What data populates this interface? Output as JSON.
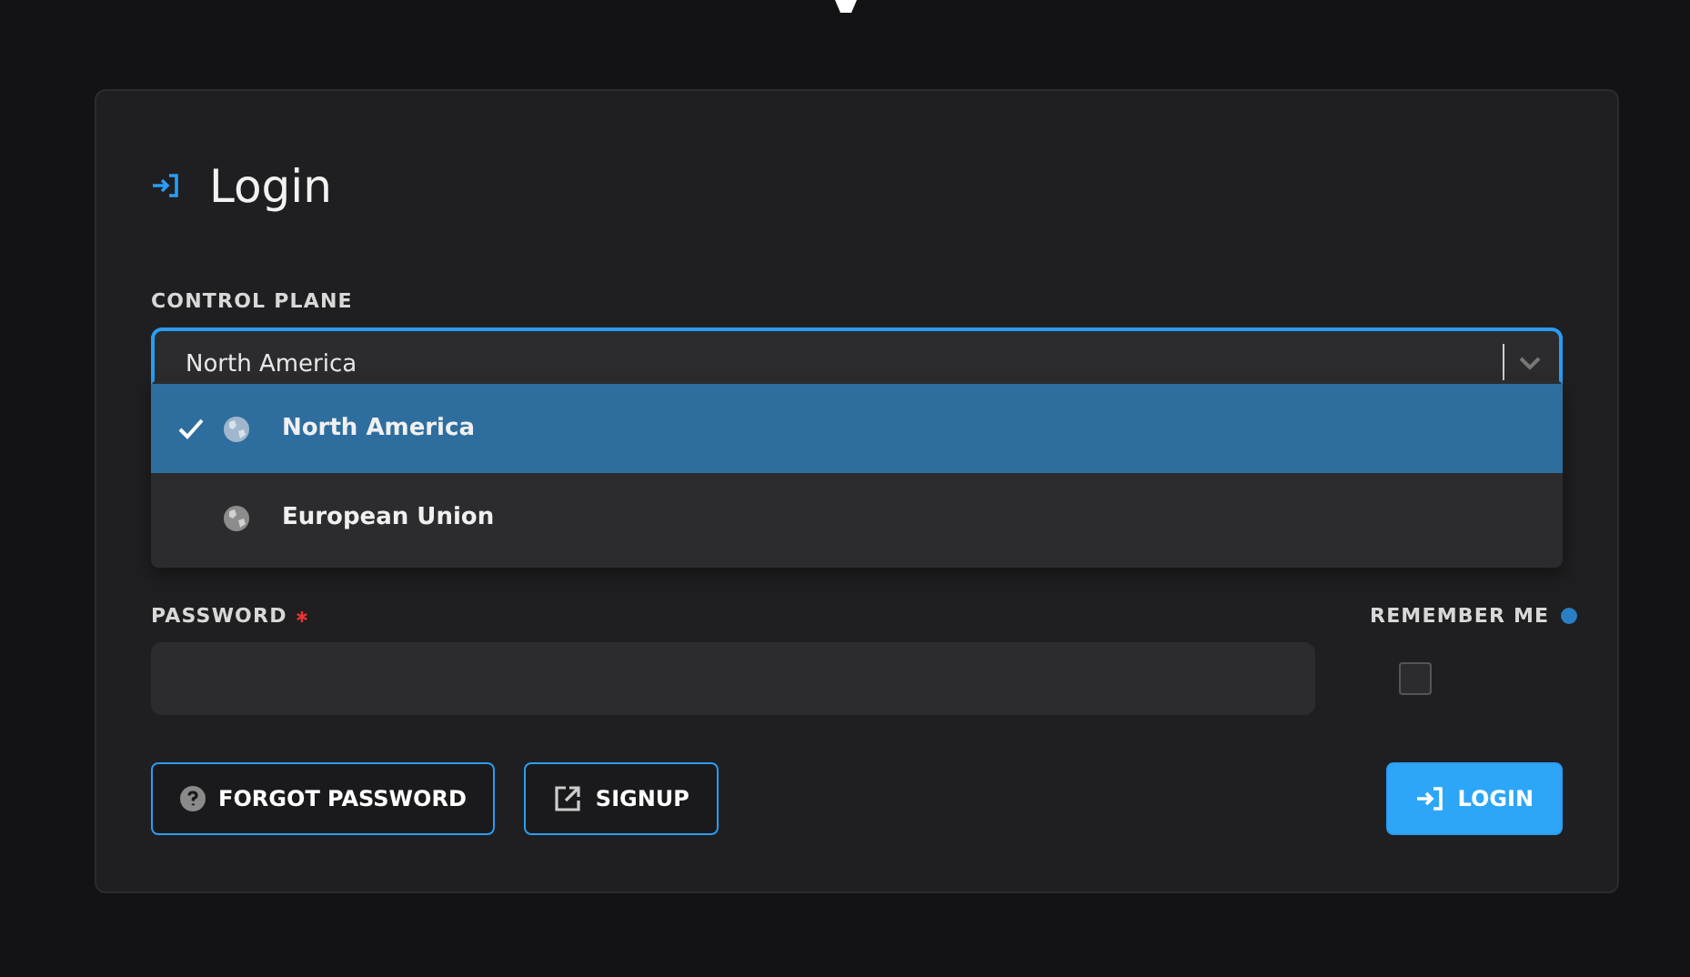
{
  "title": "Login",
  "control_plane": {
    "label": "CONTROL PLANE",
    "value": "North America",
    "expanded": true,
    "options": [
      {
        "label": "North America",
        "selected": true
      },
      {
        "label": "European Union",
        "selected": false
      }
    ]
  },
  "password": {
    "label": "PASSWORD",
    "required": true
  },
  "remember_me": {
    "label": "REMEMBER ME",
    "checked": false
  },
  "buttons": [
    {
      "kind": "forgot",
      "label": "FORGOT PASSWORD"
    },
    {
      "kind": "signup",
      "label": "SIGNUP"
    },
    {
      "kind": "login",
      "label": "LOGIN"
    }
  ]
}
